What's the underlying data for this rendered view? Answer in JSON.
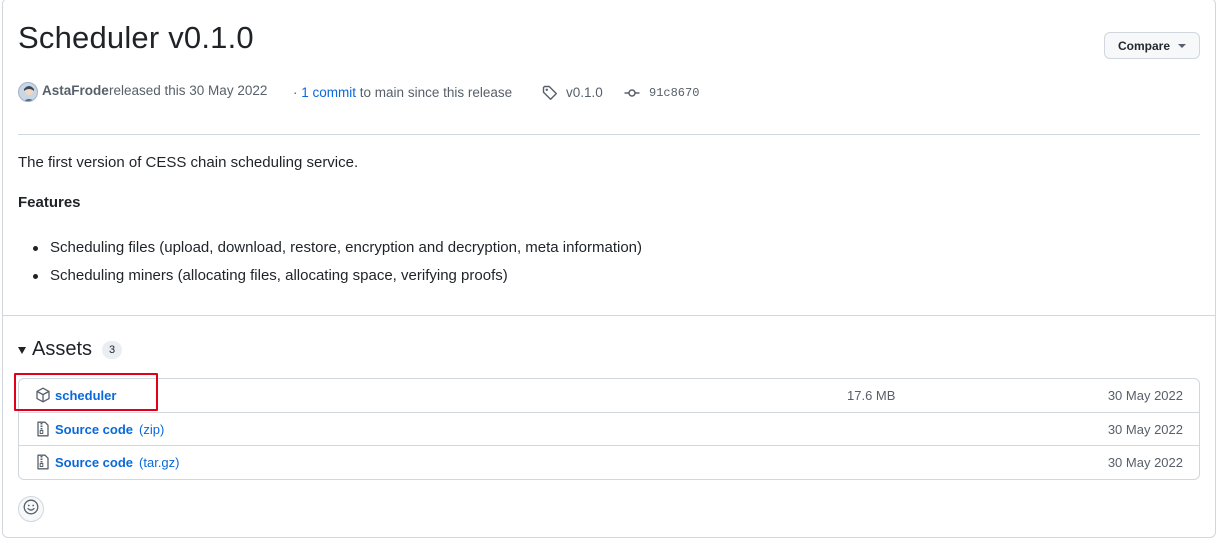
{
  "release": {
    "title": "Scheduler v0.1.0",
    "compare_label": "Compare",
    "author": "AstaFrode",
    "released_text": "released this 30 May 2022",
    "commit_separator": "·",
    "commit_link": "1 commit",
    "commit_suffix": "to main since this release",
    "tag": "v0.1.0",
    "sha": "91c8670",
    "description": "The first version of CESS chain scheduling service.",
    "features_heading": "Features",
    "features": [
      "Scheduling files (upload, download, restore, encryption and decryption, meta information)",
      "Scheduling miners (allocating files, allocating space, verifying proofs)"
    ]
  },
  "assets": {
    "heading": "Assets",
    "count": "3",
    "items": [
      {
        "name": "scheduler",
        "ext": "",
        "size": "17.6 MB",
        "date": "30 May 2022",
        "icon": "package-icon"
      },
      {
        "name": "Source code",
        "ext": "(zip)",
        "size": "",
        "date": "30 May 2022",
        "icon": "file-zip-icon"
      },
      {
        "name": "Source code",
        "ext": "(tar.gz)",
        "size": "",
        "date": "30 May 2022",
        "icon": "file-zip-icon"
      }
    ]
  },
  "icons": {
    "tag": "tag-icon",
    "commit": "git-commit-icon",
    "reaction": "smiley-icon",
    "caret": "chevron-down-icon"
  },
  "colors": {
    "link": "#0969da",
    "highlight": "#e0001a"
  }
}
